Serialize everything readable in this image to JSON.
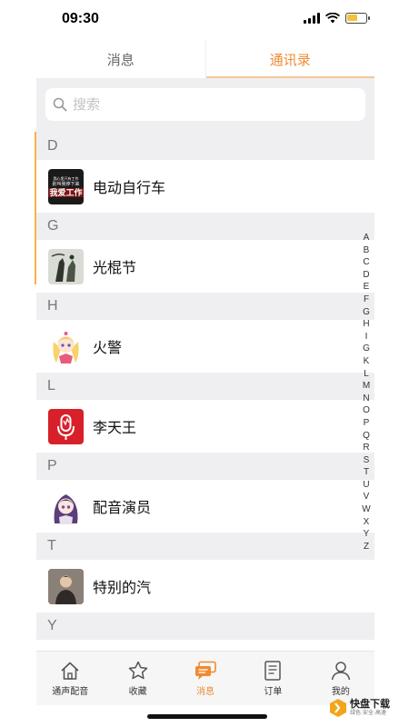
{
  "status_bar": {
    "time": "09:30",
    "battery_level": 0.6
  },
  "tabs": [
    {
      "label": "消息",
      "active": false
    },
    {
      "label": "通讯录",
      "active": true
    }
  ],
  "search": {
    "placeholder": "搜索"
  },
  "sections": [
    {
      "letter": "D",
      "contacts": [
        {
          "name": "电动自行车",
          "avatar": "poster-avatar"
        }
      ]
    },
    {
      "letter": "G",
      "contacts": [
        {
          "name": "光棍节",
          "avatar": "ink-painting-avatar"
        }
      ]
    },
    {
      "letter": "H",
      "contacts": [
        {
          "name": "火警",
          "avatar": "anime-girl-avatar"
        }
      ]
    },
    {
      "letter": "L",
      "contacts": [
        {
          "name": "李天王",
          "avatar": "red-microphone-avatar"
        }
      ]
    },
    {
      "letter": "P",
      "contacts": [
        {
          "name": "配音演员",
          "avatar": "purple-hair-avatar"
        }
      ]
    },
    {
      "letter": "T",
      "contacts": [
        {
          "name": "特别的汽",
          "avatar": "man-photo-avatar"
        }
      ]
    },
    {
      "letter": "Y",
      "contacts": []
    }
  ],
  "avatar_texts": {
    "poster": {
      "line1": "我心里只有工作",
      "line2": "别叫我停下来",
      "line3": "我爱工作"
    }
  },
  "alpha_index": [
    "A",
    "B",
    "C",
    "D",
    "E",
    "F",
    "G",
    "H",
    "I",
    "G",
    "K",
    "L",
    "M",
    "N",
    "O",
    "P",
    "Q",
    "R",
    "S",
    "T",
    "U",
    "V",
    "W",
    "X",
    "Y",
    "Z"
  ],
  "bottom_nav": [
    {
      "label": "通声配音",
      "icon": "home-icon",
      "active": false
    },
    {
      "label": "收藏",
      "icon": "star-icon",
      "active": false
    },
    {
      "label": "消息",
      "icon": "chat-bubbles-icon",
      "active": true
    },
    {
      "label": "订单",
      "icon": "order-list-icon",
      "active": false
    },
    {
      "label": "我的",
      "icon": "person-icon",
      "active": false
    }
  ],
  "colors": {
    "accent": "#f08a32",
    "accent_light": "#f6b34a",
    "section_bg": "#efeff1"
  },
  "watermark": {
    "title": "快盘下载",
    "subtitle": "绿色·安全·高速"
  }
}
